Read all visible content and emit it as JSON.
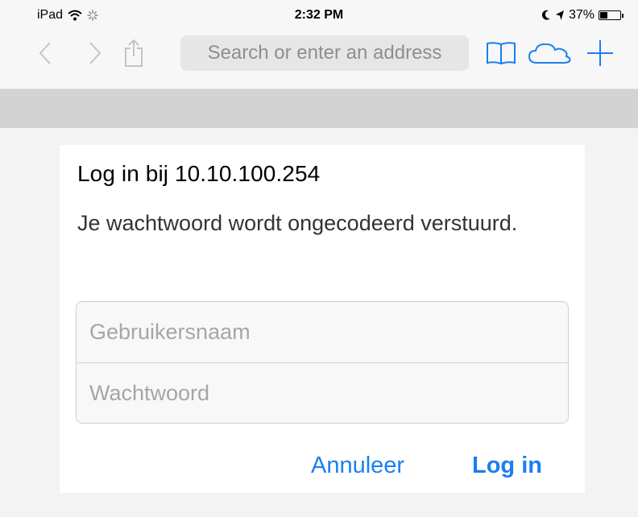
{
  "status_bar": {
    "device": "iPad",
    "time": "2:32 PM",
    "battery_percent": "37%",
    "battery_level": 0.37
  },
  "browser": {
    "address_placeholder": "Search or enter an address",
    "accent_color": "#1a7ff0",
    "icons": [
      "back-icon",
      "forward-icon",
      "share-icon",
      "bookmarks-icon",
      "icloud-tabs-icon",
      "new-tab-icon"
    ]
  },
  "dialog": {
    "title": "Log in bij 10.10.100.254",
    "message": "Je wachtwoord wordt ongecodeerd verstuurd.",
    "username_placeholder": "Gebruikersnaam",
    "password_placeholder": "Wachtwoord",
    "cancel_label": "Annuleer",
    "login_label": "Log in"
  }
}
